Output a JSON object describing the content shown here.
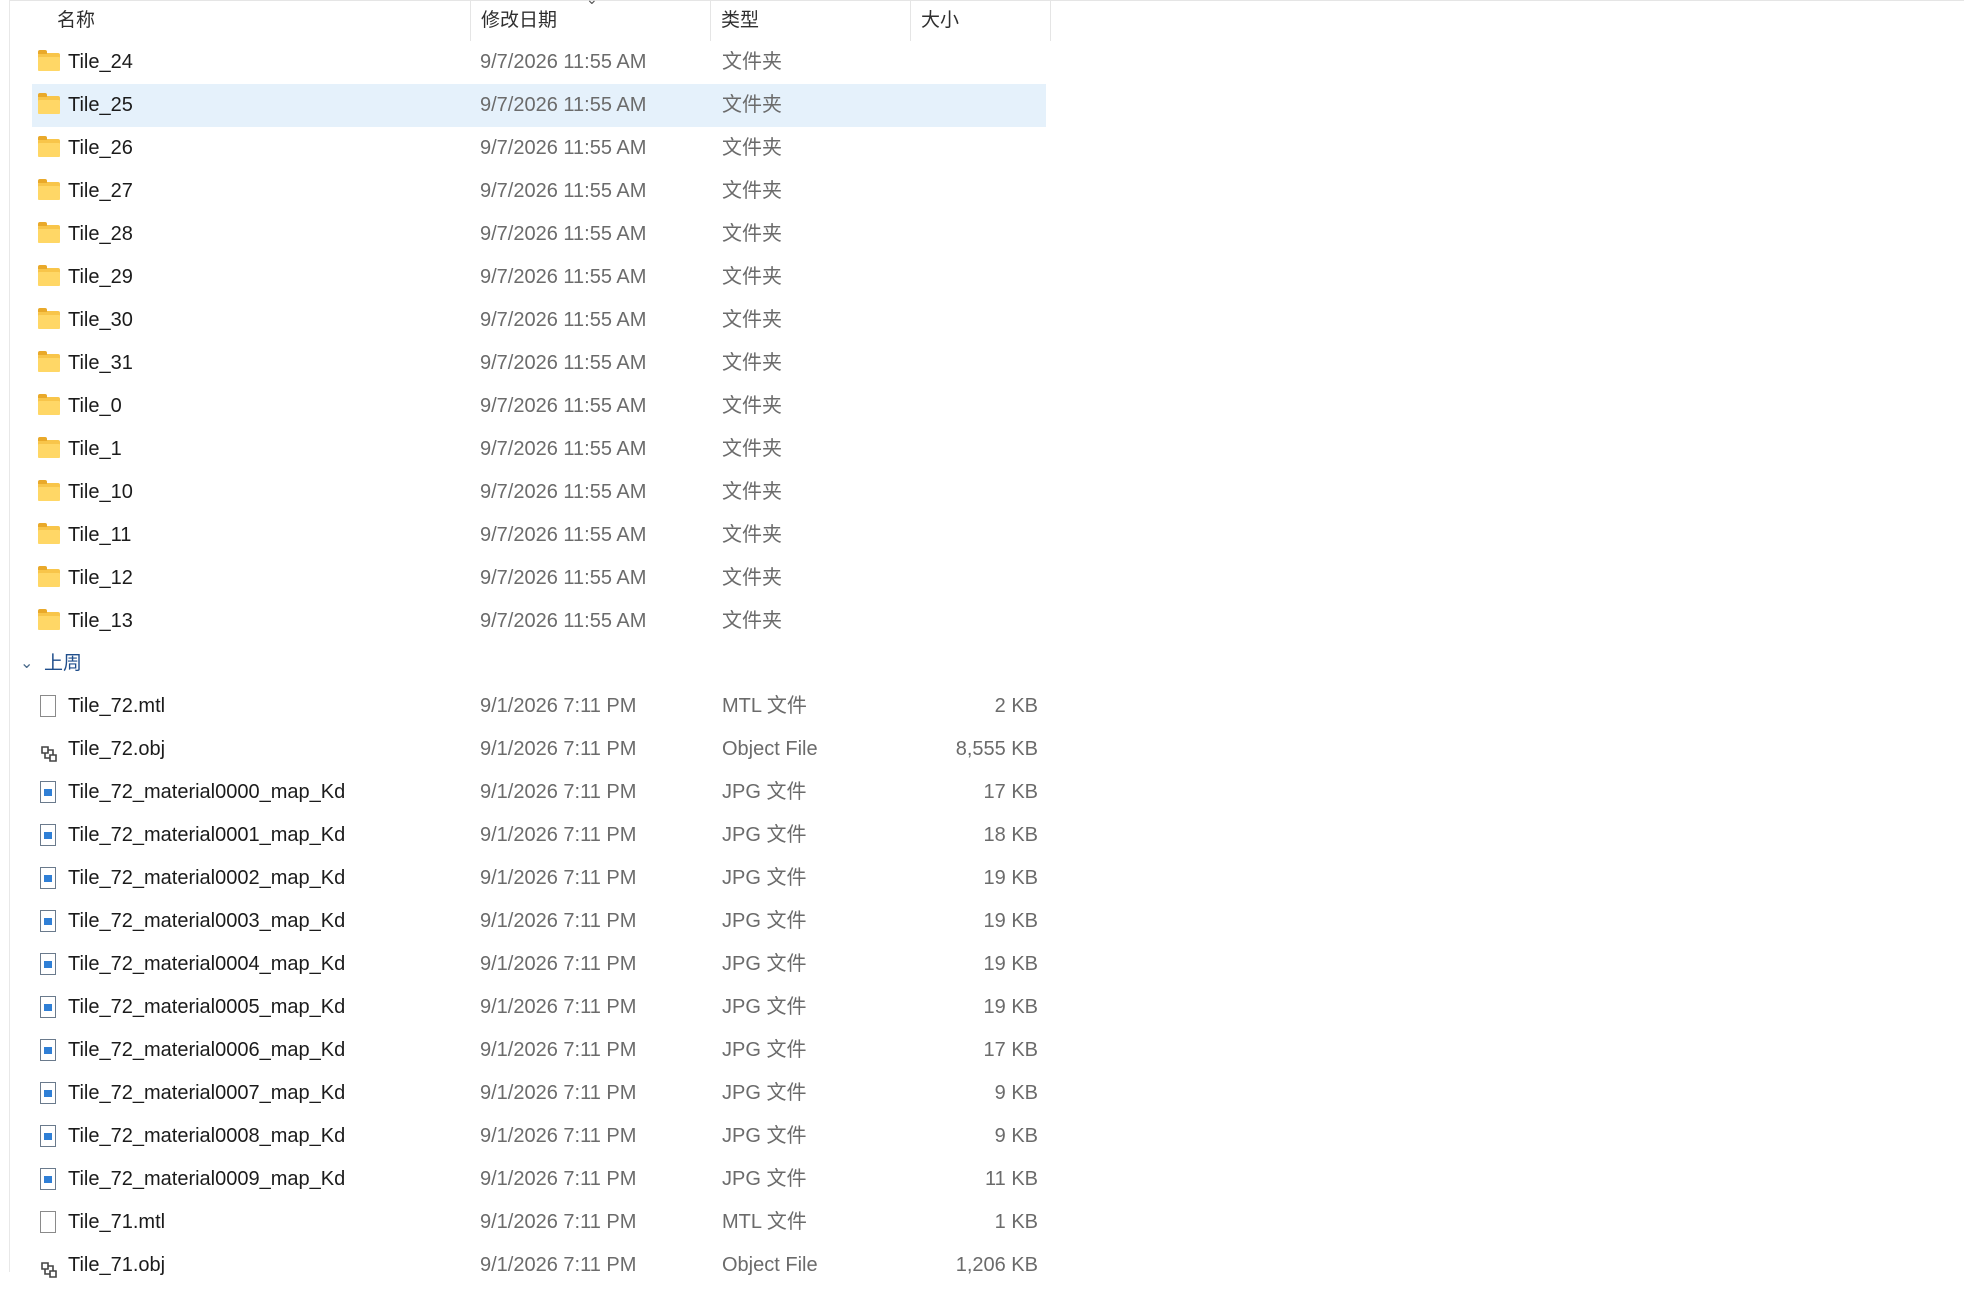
{
  "header": {
    "name": "名称",
    "date": "修改日期",
    "type": "类型",
    "size": "大小"
  },
  "folders": [
    {
      "name": "Tile_24",
      "date": "9/7/2026 11:55 AM",
      "type": "文件夹",
      "size": ""
    },
    {
      "name": "Tile_25",
      "date": "9/7/2026 11:55 AM",
      "type": "文件夹",
      "size": ""
    },
    {
      "name": "Tile_26",
      "date": "9/7/2026 11:55 AM",
      "type": "文件夹",
      "size": ""
    },
    {
      "name": "Tile_27",
      "date": "9/7/2026 11:55 AM",
      "type": "文件夹",
      "size": ""
    },
    {
      "name": "Tile_28",
      "date": "9/7/2026 11:55 AM",
      "type": "文件夹",
      "size": ""
    },
    {
      "name": "Tile_29",
      "date": "9/7/2026 11:55 AM",
      "type": "文件夹",
      "size": ""
    },
    {
      "name": "Tile_30",
      "date": "9/7/2026 11:55 AM",
      "type": "文件夹",
      "size": ""
    },
    {
      "name": "Tile_31",
      "date": "9/7/2026 11:55 AM",
      "type": "文件夹",
      "size": ""
    },
    {
      "name": "Tile_0",
      "date": "9/7/2026 11:55 AM",
      "type": "文件夹",
      "size": ""
    },
    {
      "name": "Tile_1",
      "date": "9/7/2026 11:55 AM",
      "type": "文件夹",
      "size": ""
    },
    {
      "name": "Tile_10",
      "date": "9/7/2026 11:55 AM",
      "type": "文件夹",
      "size": ""
    },
    {
      "name": "Tile_11",
      "date": "9/7/2026 11:55 AM",
      "type": "文件夹",
      "size": ""
    },
    {
      "name": "Tile_12",
      "date": "9/7/2026 11:55 AM",
      "type": "文件夹",
      "size": ""
    },
    {
      "name": "Tile_13",
      "date": "9/7/2026 11:55 AM",
      "type": "文件夹",
      "size": ""
    }
  ],
  "group_label": "上周",
  "files": [
    {
      "name": "Tile_72.mtl",
      "date": "9/1/2026 7:11 PM",
      "type": "MTL 文件",
      "size": "2 KB",
      "icon": "file"
    },
    {
      "name": "Tile_72.obj",
      "date": "9/1/2026 7:11 PM",
      "type": "Object File",
      "size": "8,555 KB",
      "icon": "obj"
    },
    {
      "name": "Tile_72_material0000_map_Kd",
      "date": "9/1/2026 7:11 PM",
      "type": "JPG 文件",
      "size": "17 KB",
      "icon": "jpg"
    },
    {
      "name": "Tile_72_material0001_map_Kd",
      "date": "9/1/2026 7:11 PM",
      "type": "JPG 文件",
      "size": "18 KB",
      "icon": "jpg"
    },
    {
      "name": "Tile_72_material0002_map_Kd",
      "date": "9/1/2026 7:11 PM",
      "type": "JPG 文件",
      "size": "19 KB",
      "icon": "jpg"
    },
    {
      "name": "Tile_72_material0003_map_Kd",
      "date": "9/1/2026 7:11 PM",
      "type": "JPG 文件",
      "size": "19 KB",
      "icon": "jpg"
    },
    {
      "name": "Tile_72_material0004_map_Kd",
      "date": "9/1/2026 7:11 PM",
      "type": "JPG 文件",
      "size": "19 KB",
      "icon": "jpg"
    },
    {
      "name": "Tile_72_material0005_map_Kd",
      "date": "9/1/2026 7:11 PM",
      "type": "JPG 文件",
      "size": "19 KB",
      "icon": "jpg"
    },
    {
      "name": "Tile_72_material0006_map_Kd",
      "date": "9/1/2026 7:11 PM",
      "type": "JPG 文件",
      "size": "17 KB",
      "icon": "jpg"
    },
    {
      "name": "Tile_72_material0007_map_Kd",
      "date": "9/1/2026 7:11 PM",
      "type": "JPG 文件",
      "size": "9 KB",
      "icon": "jpg"
    },
    {
      "name": "Tile_72_material0008_map_Kd",
      "date": "9/1/2026 7:11 PM",
      "type": "JPG 文件",
      "size": "9 KB",
      "icon": "jpg"
    },
    {
      "name": "Tile_72_material0009_map_Kd",
      "date": "9/1/2026 7:11 PM",
      "type": "JPG 文件",
      "size": "11 KB",
      "icon": "jpg"
    },
    {
      "name": "Tile_71.mtl",
      "date": "9/1/2026 7:11 PM",
      "type": "MTL 文件",
      "size": "1 KB",
      "icon": "file"
    },
    {
      "name": "Tile_71.obj",
      "date": "9/1/2026 7:11 PM",
      "type": "Object File",
      "size": "1,206 KB",
      "icon": "obj"
    }
  ],
  "selected_folder": "Tile_25"
}
